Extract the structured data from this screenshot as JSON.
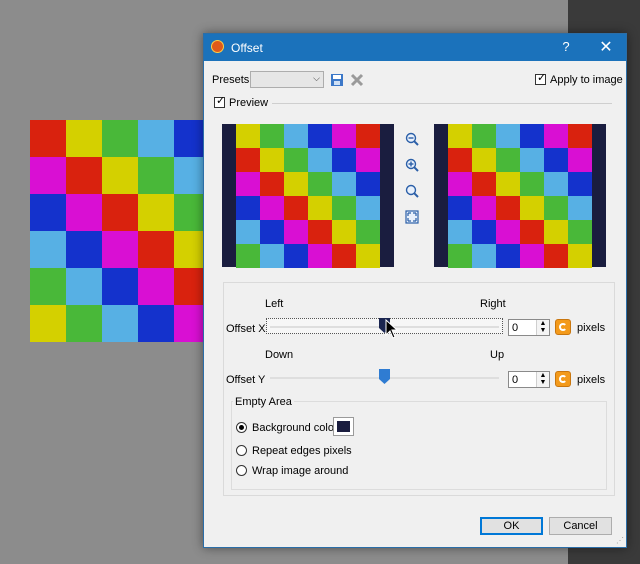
{
  "dialog": {
    "title": "Offset",
    "help_glyph": "?",
    "close_glyph": "✕",
    "app_icon": "app-icon"
  },
  "presets": {
    "label": "Presets:",
    "value": "",
    "save_icon": "save-icon",
    "delete_icon": "delete-icon"
  },
  "apply_to_image": {
    "label": "Apply to image",
    "checked": true
  },
  "preview": {
    "label": "Preview",
    "checked": true
  },
  "zoom_tools": [
    "zoom-out-icon",
    "zoom-in-icon",
    "zoom-fit-icon",
    "fit-window-icon"
  ],
  "offset_x": {
    "label": "Offset X",
    "left_label": "Left",
    "right_label": "Right",
    "value": "0",
    "unit": "pixels",
    "position": 0.5
  },
  "offset_y": {
    "label": "Offset Y",
    "down_label": "Down",
    "up_label": "Up",
    "value": "0",
    "unit": "pixels",
    "position": 0.5
  },
  "empty_area": {
    "title": "Empty Area",
    "options": [
      {
        "label": "Background color",
        "selected": true
      },
      {
        "label": "Repeat edges pixels",
        "selected": false
      },
      {
        "label": "Wrap image around",
        "selected": false
      }
    ],
    "background_color": "#1a1d3f"
  },
  "buttons": {
    "ok": "OK",
    "cancel": "Cancel"
  },
  "colors": {
    "red": "#d9220e",
    "yellow": "#d4d000",
    "green": "#49b839",
    "lightblue": "#57b0e4",
    "blue": "#1432cc",
    "magenta": "#d90fd3",
    "titlebar": "#1b72bb"
  },
  "canvas_pattern": [
    [
      "red",
      "yellow",
      "green",
      "lightblue",
      "blue",
      "magenta"
    ],
    [
      "magenta",
      "red",
      "yellow",
      "green",
      "lightblue",
      "blue"
    ],
    [
      "blue",
      "magenta",
      "red",
      "yellow",
      "green",
      "lightblue"
    ],
    [
      "lightblue",
      "blue",
      "magenta",
      "red",
      "yellow",
      "green"
    ],
    [
      "green",
      "lightblue",
      "blue",
      "magenta",
      "red",
      "yellow"
    ],
    [
      "yellow",
      "green",
      "lightblue",
      "blue",
      "magenta",
      "red"
    ]
  ]
}
